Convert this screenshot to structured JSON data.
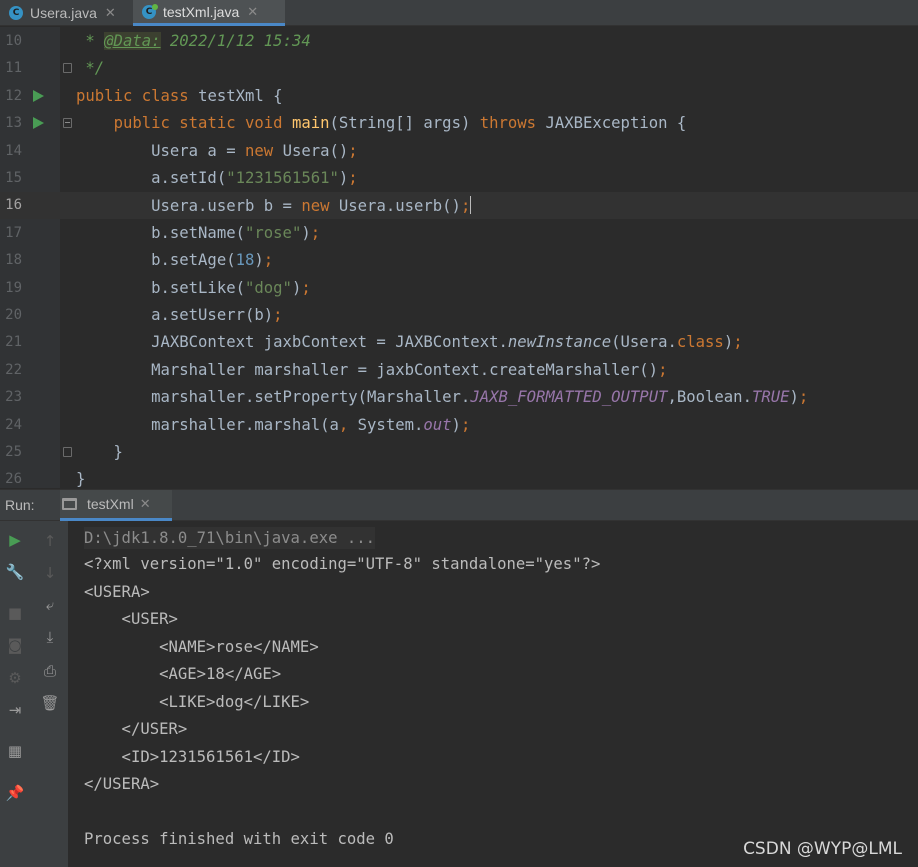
{
  "tabs": [
    {
      "icon": "java-class-icon",
      "label": "Usera.java",
      "active": false
    },
    {
      "icon": "java-runnable-class-icon",
      "label": "testXml.java",
      "active": true
    }
  ],
  "editor": {
    "lines": [
      {
        "num": "10",
        "run": false,
        "fold": "",
        "tokens": [
          [
            "cmt",
            " * "
          ],
          [
            "tag",
            "@Data:"
          ],
          [
            "cmt",
            " 2022/1/12 15:34"
          ]
        ]
      },
      {
        "num": "11",
        "run": false,
        "fold": "end",
        "tokens": [
          [
            "cmt",
            " */"
          ]
        ]
      },
      {
        "num": "12",
        "run": true,
        "fold": "",
        "tokens": [
          [
            "kw",
            "public class "
          ],
          [
            "",
            "testXml {"
          ]
        ]
      },
      {
        "num": "13",
        "run": true,
        "fold": "open",
        "tokens": [
          [
            "",
            "    "
          ],
          [
            "kw",
            "public static void "
          ],
          [
            "mth",
            "main"
          ],
          [
            "",
            "(String[] args) "
          ],
          [
            "kw",
            "throws "
          ],
          [
            "",
            "JAXBException {"
          ]
        ]
      },
      {
        "num": "14",
        "run": false,
        "fold": "",
        "tokens": [
          [
            "",
            "        Usera a = "
          ],
          [
            "kw",
            "new "
          ],
          [
            "",
            "Usera()"
          ],
          [
            "kw",
            ";"
          ]
        ]
      },
      {
        "num": "15",
        "run": false,
        "fold": "",
        "tokens": [
          [
            "",
            "        a.setId("
          ],
          [
            "str",
            "\"1231561561\""
          ],
          [
            "",
            ")"
          ],
          [
            "kw",
            ";"
          ]
        ]
      },
      {
        "num": "16",
        "run": false,
        "fold": "",
        "current": true,
        "tokens": [
          [
            "",
            "        Usera.userb b = "
          ],
          [
            "kw",
            "new "
          ],
          [
            "",
            "Usera.userb()"
          ],
          [
            "kw",
            ";"
          ]
        ]
      },
      {
        "num": "17",
        "run": false,
        "fold": "",
        "tokens": [
          [
            "",
            "        b.setName("
          ],
          [
            "str",
            "\"rose\""
          ],
          [
            "",
            ")"
          ],
          [
            "kw",
            ";"
          ]
        ]
      },
      {
        "num": "18",
        "run": false,
        "fold": "",
        "tokens": [
          [
            "",
            "        b.setAge("
          ],
          [
            "num",
            "18"
          ],
          [
            "",
            ")"
          ],
          [
            "kw",
            ";"
          ]
        ]
      },
      {
        "num": "19",
        "run": false,
        "fold": "",
        "tokens": [
          [
            "",
            "        b.setLike("
          ],
          [
            "str",
            "\"dog\""
          ],
          [
            "",
            ")"
          ],
          [
            "kw",
            ";"
          ]
        ]
      },
      {
        "num": "20",
        "run": false,
        "fold": "",
        "tokens": [
          [
            "",
            "        a.setUserr(b)"
          ],
          [
            "kw",
            ";"
          ]
        ]
      },
      {
        "num": "21",
        "run": false,
        "fold": "",
        "tokens": [
          [
            "",
            "        JAXBContext jaxbContext = JAXBContext."
          ],
          [
            "ital",
            "newInstance"
          ],
          [
            "",
            "(Usera."
          ],
          [
            "kw",
            "class"
          ],
          [
            "",
            ")"
          ],
          [
            "kw",
            ";"
          ]
        ]
      },
      {
        "num": "22",
        "run": false,
        "fold": "",
        "tokens": [
          [
            "",
            "        Marshaller marshaller = jaxbContext.createMarshaller()"
          ],
          [
            "kw",
            ";"
          ]
        ]
      },
      {
        "num": "23",
        "run": false,
        "fold": "",
        "tokens": [
          [
            "",
            "        marshaller.setProperty(Marshaller."
          ],
          [
            "fld",
            "JAXB_FORMATTED_OUTPUT"
          ],
          [
            "",
            ",Boolean."
          ],
          [
            "fld",
            "TRUE"
          ],
          [
            "",
            ")"
          ],
          [
            "kw",
            ";"
          ]
        ]
      },
      {
        "num": "24",
        "run": false,
        "fold": "",
        "tokens": [
          [
            "",
            "        marshaller.marshal(a"
          ],
          [
            "kw",
            ", "
          ],
          [
            "",
            "System."
          ],
          [
            "fld",
            "out"
          ],
          [
            "",
            ")"
          ],
          [
            "kw",
            ";"
          ]
        ]
      },
      {
        "num": "25",
        "run": false,
        "fold": "end",
        "tokens": [
          [
            "",
            "    }"
          ]
        ]
      },
      {
        "num": "26",
        "run": false,
        "fold": "",
        "tokens": [
          [
            "",
            "}"
          ]
        ]
      }
    ]
  },
  "run_panel": {
    "label": "Run:",
    "tab_label": "testXml",
    "left_tools": [
      "rerun-icon",
      "wrench-icon",
      "stop-icon",
      "camera-icon",
      "settings-gear-icon",
      "login-icon",
      "layout-icon",
      "pin-icon"
    ],
    "right_tools": [
      "up-arrow-icon",
      "down-arrow-icon",
      "soft-wrap-icon",
      "scroll-to-end-icon",
      "print-icon",
      "trash-icon"
    ]
  },
  "console": {
    "command": "D:\\jdk1.8.0_71\\bin\\java.exe ...",
    "output": [
      "<?xml version=\"1.0\" encoding=\"UTF-8\" standalone=\"yes\"?>",
      "<USERA>",
      "    <USER>",
      "        <NAME>rose</NAME>",
      "        <AGE>18</AGE>",
      "        <LIKE>dog</LIKE>",
      "    </USER>",
      "    <ID>1231561561</ID>",
      "</USERA>",
      "",
      "Process finished with exit code 0"
    ]
  },
  "watermark": "CSDN @WYP@LML"
}
